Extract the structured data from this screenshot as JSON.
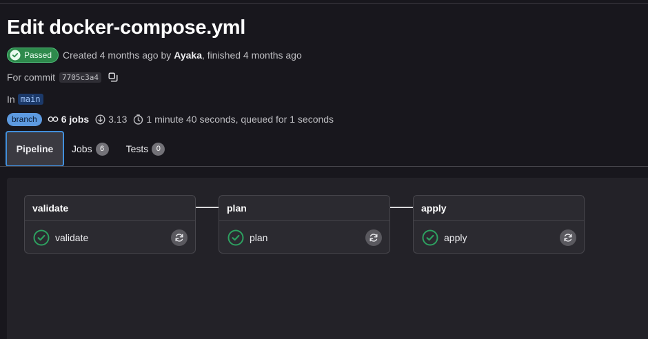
{
  "pipeline": {
    "title": "Edit docker-compose.yml",
    "status": "Passed",
    "created_text": "Created 4 months ago by",
    "author": "Ayaka",
    "finished_text": ", finished 4 months ago",
    "commit_label": "For commit",
    "commit_sha": "7705c3a4",
    "branch_label": "In",
    "branch": "main",
    "type_badge": "branch",
    "jobs_count": "6 jobs",
    "version": "3.13",
    "duration": "1 minute 40 seconds, queued for 1 seconds"
  },
  "tabs": [
    {
      "label": "Pipeline"
    },
    {
      "label": "Jobs",
      "count": "6"
    },
    {
      "label": "Tests",
      "count": "0"
    }
  ],
  "stages": [
    {
      "name": "validate",
      "job": "validate"
    },
    {
      "name": "plan",
      "job": "plan"
    },
    {
      "name": "apply",
      "job": "apply"
    }
  ],
  "colors": {
    "success": "#2da160",
    "accent": "#428fdc",
    "background": "#18171d"
  },
  "icons": {
    "status": "check-circle-icon",
    "copy": "copy-icon",
    "jobs": "pipeline-icon",
    "version": "download-icon",
    "duration": "clock-icon",
    "retry": "retry-icon"
  }
}
